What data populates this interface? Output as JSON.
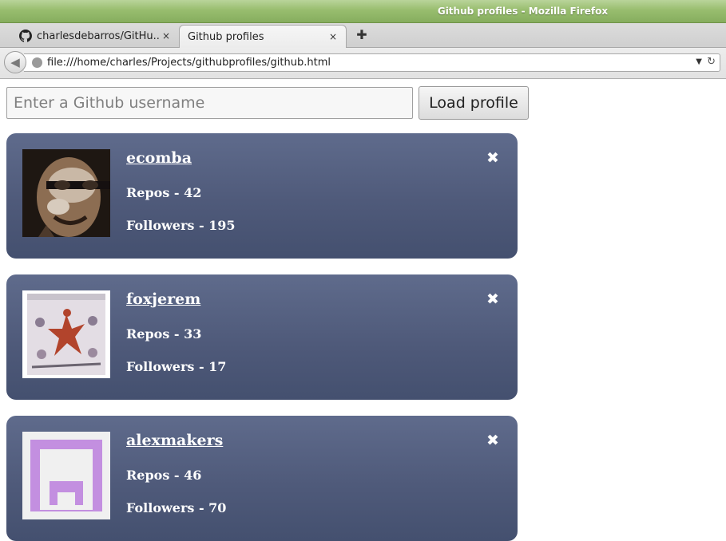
{
  "window": {
    "title": "Github profiles - Mozilla Firefox"
  },
  "tabs": [
    {
      "label": "charlesdebarros/GitHu...",
      "icon": "github-icon"
    },
    {
      "label": "Github profiles"
    }
  ],
  "tab_close_symbol": "×",
  "new_tab_symbol": "✚",
  "navbar": {
    "url": "file:///home/charles/Projects/githubprofiles/github.html",
    "back_symbol": "◀",
    "dropdown_symbol": "▼",
    "reload_symbol": "↻"
  },
  "form": {
    "placeholder": "Enter a Github username",
    "value": "",
    "load_button_label": "Load profile"
  },
  "card_close_symbol": "✖",
  "profiles": [
    {
      "username": "ecomba",
      "repos_text": "Repos - 42",
      "followers_text": "Followers - 195"
    },
    {
      "username": "foxjerem",
      "repos_text": "Repos - 33",
      "followers_text": "Followers - 17"
    },
    {
      "username": "alexmakers",
      "repos_text": "Repos - 46",
      "followers_text": "Followers - 70"
    }
  ],
  "colors": {
    "card_top": "#5f6b8c",
    "card_bottom": "#44506f",
    "titlebar": "#98bd6e",
    "identicon": "#c38fe0"
  }
}
